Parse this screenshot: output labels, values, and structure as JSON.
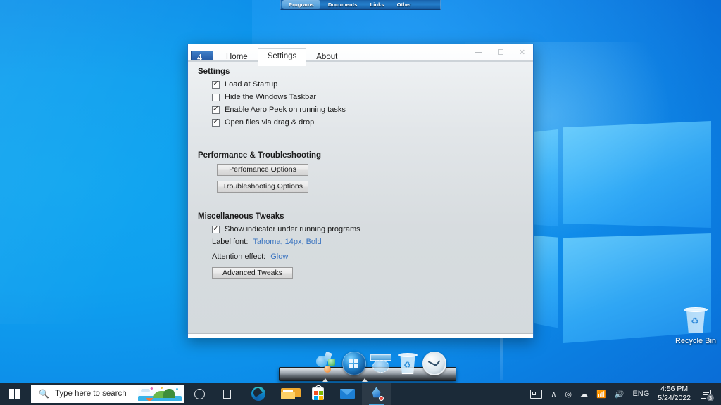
{
  "desktop": {
    "recycle_bin_label": "Recycle Bin",
    "wallpaper_accent": "#0c8ae8"
  },
  "top_dock": {
    "tabs": [
      {
        "label": "Programs",
        "active": true
      },
      {
        "label": "Documents",
        "active": false
      },
      {
        "label": "Links",
        "active": false
      },
      {
        "label": "Other",
        "active": false
      }
    ]
  },
  "bottom_dock": {
    "icons": [
      "shapes-icon",
      "windows-orb-icon",
      "blue-sign-icon",
      "recycle-bin-icon",
      "clock-icon"
    ]
  },
  "app_window": {
    "logo_glyph": "4",
    "tabs": [
      {
        "label": "Home",
        "active": false
      },
      {
        "label": "Settings",
        "active": true
      },
      {
        "label": "About",
        "active": false
      }
    ],
    "controls": {
      "minimize": "minimize-button",
      "maximize": "maximize-button",
      "close": "✕"
    },
    "sections": {
      "settings": {
        "heading": "Settings",
        "checkboxes": [
          {
            "label": "Load at Startup",
            "checked": true
          },
          {
            "label": "Hide the Windows Taskbar",
            "checked": false
          },
          {
            "label": "Enable Aero Peek on running tasks",
            "checked": true
          },
          {
            "label": "Open files via drag & drop",
            "checked": true
          }
        ]
      },
      "performance": {
        "heading": "Performance & Troubleshooting",
        "buttons": [
          {
            "label": "Perfomance Options"
          },
          {
            "label": "Troubleshooting Options"
          }
        ]
      },
      "misc": {
        "heading": "Miscellaneous Tweaks",
        "checkbox": {
          "label": "Show indicator under running programs",
          "checked": true
        },
        "label_font": {
          "key": "Label font:",
          "value": "Tahoma, 14px, Bold"
        },
        "attention_effect": {
          "key": "Attention effect:",
          "value": "Glow"
        },
        "advanced_button": "Advanced Tweaks",
        "link_color": "#3a74c0"
      }
    }
  },
  "taskbar": {
    "start": "start-button",
    "search": {
      "placeholder": "Type here to search",
      "icon": "search-icon"
    },
    "cortana": "cortana-icon",
    "pinned": [
      {
        "name": "task-view-icon"
      },
      {
        "name": "edge-icon"
      },
      {
        "name": "file-explorer-icon"
      },
      {
        "name": "microsoft-store-icon"
      },
      {
        "name": "mail-icon"
      },
      {
        "name": "app-icon",
        "active": true
      }
    ],
    "tray": {
      "news": "news-and-interests-icon",
      "chevron": "∧",
      "camera": "camera-icon",
      "onedrive": "onedrive-icon",
      "network": "wifi-icon",
      "volume": "volume-icon",
      "language": "ENG",
      "time": "4:56 PM",
      "date": "5/24/2022",
      "notifications_count": "3"
    }
  }
}
